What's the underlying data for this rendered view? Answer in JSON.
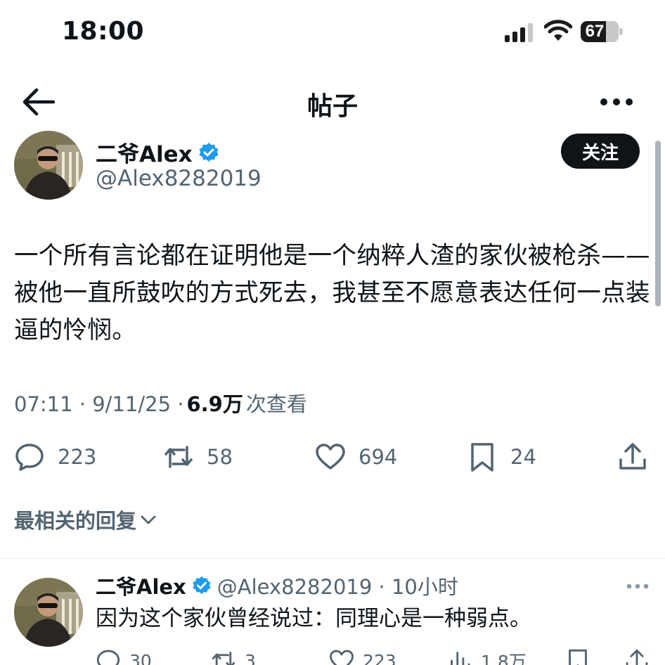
{
  "status_bar": {
    "time": "18:00",
    "battery": "67",
    "battery_level": 0.67
  },
  "nav": {
    "title": "帖子",
    "back_icon": "arrow-left-icon",
    "more_icon": "ellipsis-icon"
  },
  "post": {
    "author_name": "二爷Alex",
    "author_handle": "@Alex8282019",
    "follow_label": "关注",
    "text": "一个所有言论都在证明他是一个纳粹人渣的家伙被枪杀——被他一直所鼓吹的方式死去，我甚至不愿意表达任何一点装逼的怜悯。",
    "time": "07:11 · 9/11/25 · ",
    "views_count": "6.9万",
    "views_label": " 次查看",
    "actions": {
      "replies": "223",
      "reposts": "58",
      "likes": "694",
      "bookmarks": "24"
    }
  },
  "replies_section": {
    "title": "最相关的回复"
  },
  "reply": {
    "author_name": "二爷Alex",
    "author_handle": "@Alex8282019 · 10小时",
    "text": "因为这个家伙曾经说过：同理心是一种弱点。",
    "actions": {
      "replies": "30",
      "reposts": "3",
      "likes": "223",
      "views": "1.8万"
    }
  },
  "colors": {
    "text": "#0f1419",
    "secondary": "#536471",
    "verified": "#1d9bf0",
    "button_bg": "#0f1419"
  }
}
